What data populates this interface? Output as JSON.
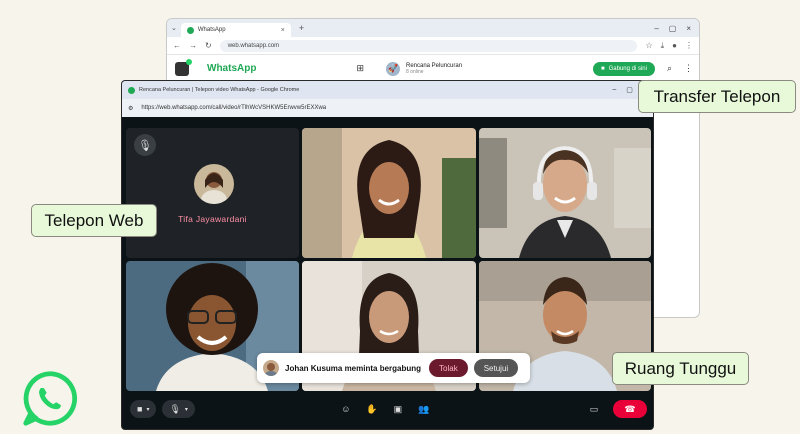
{
  "background_window": {
    "tab_title": "WhatsApp",
    "url": "web.whatsapp.com",
    "brand": "WhatsApp",
    "group_name": "Rencana Peluncuran",
    "group_status": "8 online",
    "join_button": "Gabung di sini"
  },
  "call_window": {
    "title": "Rencana Peluncuran | Telepon video WhatsApp - Google Chrome",
    "url": "https://web.whatsapp.com/call/video/rTlhWcVSHKW5Erwvw5rEXXwa",
    "audio_only_participant": "Tifa Jayawardani"
  },
  "join_request": {
    "text": "Johan Kusuma meminta bergabung",
    "reject": "Tolak",
    "accept": "Setujui"
  },
  "callouts": {
    "transfer": "Transfer Telepon",
    "web": "Telepon Web",
    "waiting_room": "Ruang Tunggu"
  },
  "colors": {
    "whatsapp_green": "#25d366",
    "end_call_red": "#ea0038",
    "callout_bg": "#e8f9d9"
  }
}
